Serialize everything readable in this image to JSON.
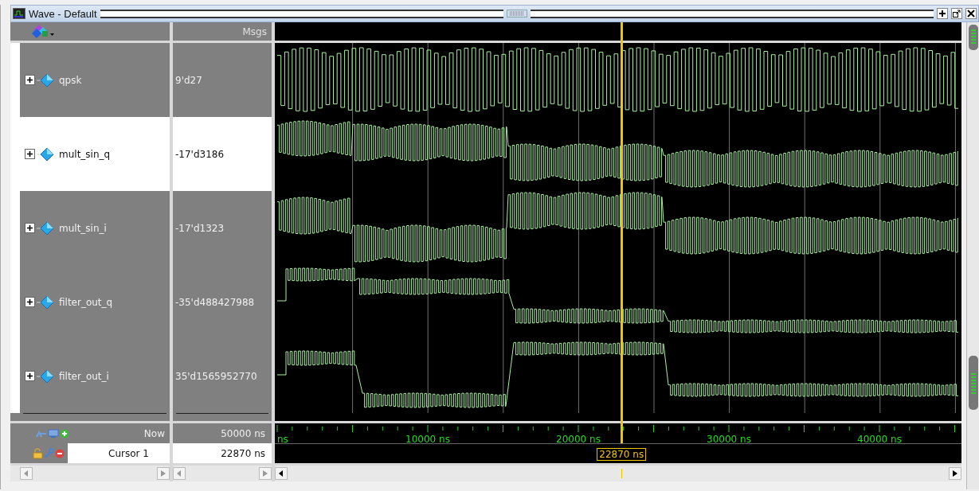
{
  "window": {
    "title": "Wave - Default"
  },
  "header": {
    "value_column": "Msgs"
  },
  "signals": [
    {
      "name": "qpsk",
      "value": "9'd27",
      "selected": false
    },
    {
      "name": "mult_sin_q",
      "value": "-17'd3186",
      "selected": true
    },
    {
      "name": "mult_sin_i",
      "value": "-17'd1323",
      "selected": false
    },
    {
      "name": "filter_out_q",
      "value": "-35'd488427988",
      "selected": false
    },
    {
      "name": "filter_out_i",
      "value": "35'd1565952770",
      "selected": false
    }
  ],
  "now": {
    "label": "Now",
    "value": "50000 ns"
  },
  "cursor": {
    "label": "Cursor 1",
    "value": "22870 ns",
    "time_label": "22870 ns"
  },
  "timeline": {
    "labels": [
      "ns",
      "10000 ns",
      "20000 ns",
      "30000 ns",
      "40000 ns"
    ]
  }
}
